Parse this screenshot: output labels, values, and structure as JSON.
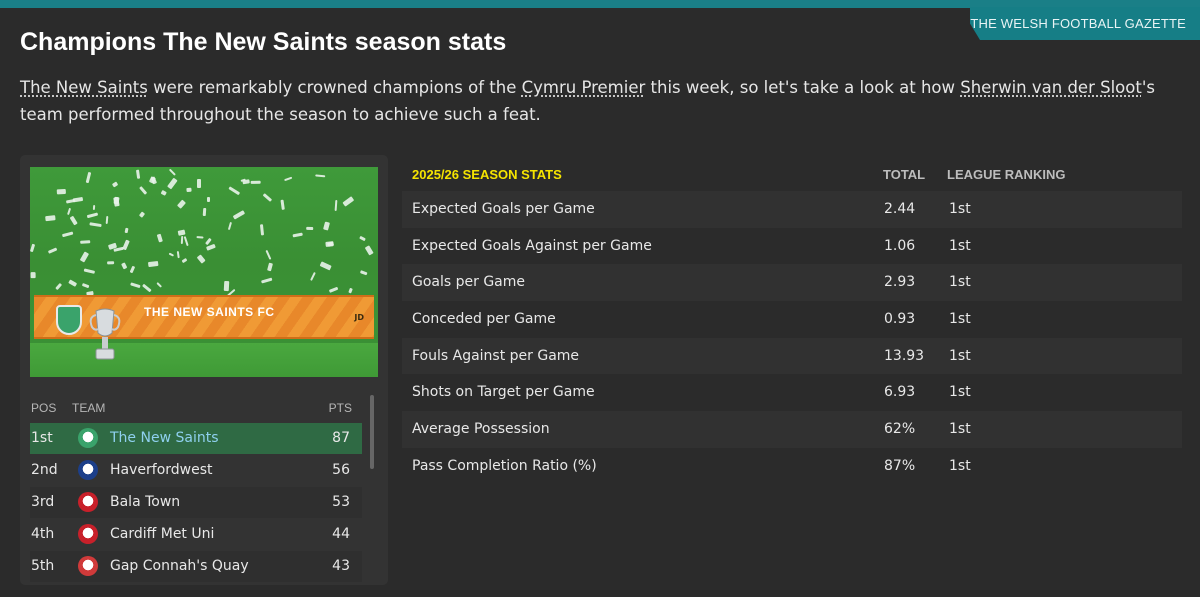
{
  "header": {
    "gazette": "THE WELSH FOOTBALL GAZETTE",
    "headline": "Champions The New Saints season stats"
  },
  "intro": {
    "team_link": "The New Saints",
    "text1": " were remarkably crowned champions of the ",
    "league_link": "Cymru Premier",
    "text2": " this week, so let's take a look at how ",
    "manager_link": "Sherwin van der Sloot",
    "text3": "'s team performed throughout the season to achieve such a feat."
  },
  "photo": {
    "banner_text": "THE NEW SAINTS FC",
    "sponsor": "JD"
  },
  "league_table": {
    "headers": {
      "pos": "POS",
      "team": "TEAM",
      "pts": "PTS"
    },
    "rows": [
      {
        "pos": "1st",
        "team": "The New Saints",
        "pts": "87",
        "crest_color": "#3aa36b",
        "highlight": true
      },
      {
        "pos": "2nd",
        "team": "Haverfordwest",
        "pts": "56",
        "crest_color": "#1c3f8a",
        "highlight": false
      },
      {
        "pos": "3rd",
        "team": "Bala Town",
        "pts": "53",
        "crest_color": "#c8202a",
        "highlight": false
      },
      {
        "pos": "4th",
        "team": "Cardiff Met Uni",
        "pts": "44",
        "crest_color": "#c8202a",
        "highlight": false
      },
      {
        "pos": "5th",
        "team": "Gap Connah's Quay",
        "pts": "43",
        "crest_color": "#d03a3a",
        "highlight": false
      }
    ]
  },
  "stats": {
    "title": "2025/26 SEASON STATS",
    "total_header": "TOTAL",
    "rank_header": "LEAGUE RANKING",
    "rows": [
      {
        "label": "Expected Goals per Game",
        "total": "2.44",
        "rank": "1st"
      },
      {
        "label": "Expected Goals Against per Game",
        "total": "1.06",
        "rank": "1st"
      },
      {
        "label": "Goals per Game",
        "total": "2.93",
        "rank": "1st"
      },
      {
        "label": "Conceded per Game",
        "total": "0.93",
        "rank": "1st"
      },
      {
        "label": "Fouls Against per Game",
        "total": "13.93",
        "rank": "1st"
      },
      {
        "label": "Shots on Target per Game",
        "total": "6.93",
        "rank": "1st"
      },
      {
        "label": "Average Possession",
        "total": "62%",
        "rank": "1st"
      },
      {
        "label": "Pass Completion Ratio (%)",
        "total": "87%",
        "rank": "1st"
      }
    ]
  },
  "colors": {
    "accent": "#1a7f87",
    "highlight_row": "#2f6a44",
    "stats_title": "#f5e400"
  }
}
